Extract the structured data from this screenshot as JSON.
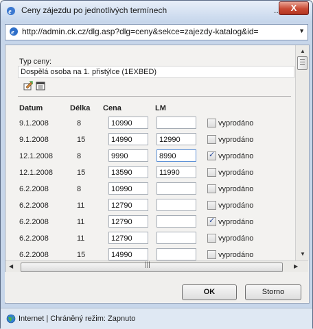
{
  "window": {
    "title": "Ceny zájezdu po jednotlivých termínech",
    "title_dots": "...",
    "close_label": "X"
  },
  "address_bar": {
    "url": "http://admin.ck.cz/dlg.asp?dlg=ceny&sekce=zajezdy-katalog&id="
  },
  "form": {
    "price_type_label": "Typ ceny:",
    "price_type_value": "Dospělá osoba na 1. přistýlce (1EXBED)",
    "headers": {
      "date": "Datum",
      "length": "Délka",
      "price": "Cena",
      "lm": "LM"
    },
    "sold_out_label": "vyprodáno",
    "rows": [
      {
        "date": "9.1.2008",
        "length": "8",
        "price": "10990",
        "lm": "",
        "sold_out": false
      },
      {
        "date": "9.1.2008",
        "length": "15",
        "price": "14990",
        "lm": "12990",
        "sold_out": false
      },
      {
        "date": "12.1.2008",
        "length": "8",
        "price": "9990",
        "lm": "8990",
        "sold_out": true
      },
      {
        "date": "12.1.2008",
        "length": "15",
        "price": "13590",
        "lm": "11990",
        "sold_out": false
      },
      {
        "date": "6.2.2008",
        "length": "8",
        "price": "10990",
        "lm": "",
        "sold_out": false
      },
      {
        "date": "6.2.2008",
        "length": "11",
        "price": "12790",
        "lm": "",
        "sold_out": false
      },
      {
        "date": "6.2.2008",
        "length": "11",
        "price": "12790",
        "lm": "",
        "sold_out": true
      },
      {
        "date": "6.2.2008",
        "length": "11",
        "price": "12790",
        "lm": "",
        "sold_out": false
      },
      {
        "date": "6.2.2008",
        "length": "15",
        "price": "14990",
        "lm": "",
        "sold_out": false
      }
    ]
  },
  "buttons": {
    "ok": "OK",
    "cancel": "Storno"
  },
  "statusbar": {
    "text": "Internet | Chráněný režim: Zapnuto"
  },
  "icons": {
    "title": "ie-icon",
    "address": "ie-page-icon",
    "edit": "edit-icon",
    "calendar": "calendar-icon",
    "status": "globe-icon"
  },
  "colors": {
    "titlebar": "#c7d7ec",
    "close": "#c94a34",
    "check": "#2a4b9b"
  }
}
